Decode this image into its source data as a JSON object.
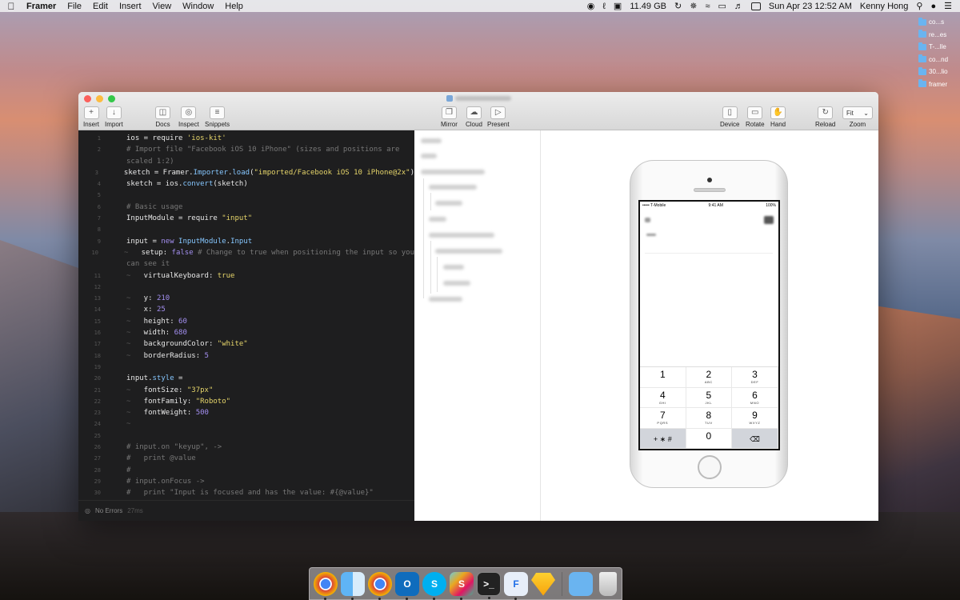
{
  "menubar": {
    "app": "Framer",
    "items": [
      "File",
      "Edit",
      "Insert",
      "View",
      "Window",
      "Help"
    ],
    "memory": "11.49 GB",
    "datetime": "Sun Apr 23  12:52 AM",
    "user": "Kenny Hong"
  },
  "desktop": {
    "files": [
      "co...s",
      "re...es",
      "T-...lle",
      "co...nd",
      "30...lio",
      "framer"
    ]
  },
  "toolbar": {
    "insert": "Insert",
    "import": "Import",
    "docs": "Docs",
    "inspect": "Inspect",
    "snippets": "Snippets",
    "mirror": "Mirror",
    "cloud": "Cloud",
    "present": "Present",
    "device": "Device",
    "rotate": "Rotate",
    "hand": "Hand",
    "reload": "Reload",
    "zoom": "Zoom",
    "zoom_value": "Fit"
  },
  "editor": {
    "status": "No Errors",
    "status_time": "27ms",
    "line_numbers": [
      "1",
      "2",
      "",
      "3",
      "4",
      "5",
      "6",
      "7",
      "8",
      "9",
      "10",
      "",
      "11",
      "12",
      "13",
      "14",
      "15",
      "16",
      "17",
      "18",
      "19",
      "20",
      "21",
      "22",
      "23",
      "24",
      "25",
      "26",
      "27",
      "28",
      "29",
      "30"
    ]
  },
  "ios": {
    "carrier": "••••• T-Mobile",
    "time": "9:41 AM",
    "battery": "100%",
    "keys": [
      {
        "d": "1",
        "sub": ""
      },
      {
        "d": "2",
        "sub": "ABC"
      },
      {
        "d": "3",
        "sub": "DEF"
      },
      {
        "d": "4",
        "sub": "GHI"
      },
      {
        "d": "5",
        "sub": "JKL"
      },
      {
        "d": "6",
        "sub": "MNO"
      },
      {
        "d": "7",
        "sub": "PQRS"
      },
      {
        "d": "8",
        "sub": "TUV"
      },
      {
        "d": "9",
        "sub": "WXYZ"
      },
      {
        "d": "+ ∗ #",
        "sub": ""
      },
      {
        "d": "0",
        "sub": ""
      },
      {
        "d": "⌫",
        "sub": ""
      }
    ]
  },
  "dock": [
    "Chrome",
    "Finder",
    "Chrome",
    "Outlook",
    "Skype",
    "Slack",
    "Terminal",
    "Framer",
    "Sketch",
    "Folder",
    "Trash"
  ]
}
